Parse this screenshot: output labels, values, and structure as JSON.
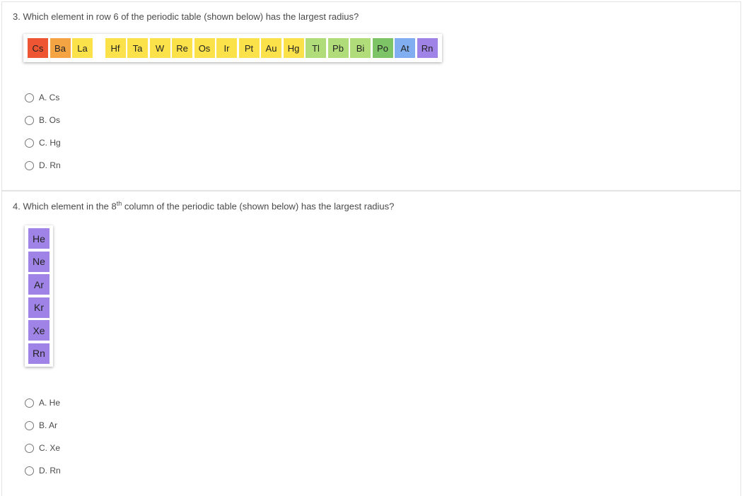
{
  "questions": [
    {
      "number": "3.",
      "text": "Which element in row 6 of the periodic table (shown below) has the largest radius?",
      "elements": [
        {
          "symbol": "Cs",
          "color": "#ee5533"
        },
        {
          "symbol": "Ba",
          "color": "#f5a444"
        },
        {
          "symbol": "La",
          "color": "#fce24a"
        },
        {
          "symbol": "Hf",
          "color": "#fce24a"
        },
        {
          "symbol": "Ta",
          "color": "#fce24a"
        },
        {
          "symbol": "W",
          "color": "#fce24a"
        },
        {
          "symbol": "Re",
          "color": "#fce24a"
        },
        {
          "symbol": "Os",
          "color": "#fce24a"
        },
        {
          "symbol": "Ir",
          "color": "#fce24a"
        },
        {
          "symbol": "Pt",
          "color": "#fce24a"
        },
        {
          "symbol": "Au",
          "color": "#fce24a"
        },
        {
          "symbol": "Hg",
          "color": "#fce24a"
        },
        {
          "symbol": "Tl",
          "color": "#b1dc7a"
        },
        {
          "symbol": "Pb",
          "color": "#b1dc7a"
        },
        {
          "symbol": "Bi",
          "color": "#b1dc7a"
        },
        {
          "symbol": "Po",
          "color": "#7cc466"
        },
        {
          "symbol": "At",
          "color": "#80aef0"
        },
        {
          "symbol": "Rn",
          "color": "#9f83e6"
        }
      ],
      "options": [
        "A. Cs",
        "B. Os",
        "C. Hg",
        "D. Rn"
      ]
    },
    {
      "number": "4.",
      "text_before": "Which element in the 8",
      "text_sup": "th",
      "text_after": " column of the periodic table (shown below) has the largest radius?",
      "elements": [
        {
          "symbol": "He",
          "color": "#9f83e6"
        },
        {
          "symbol": "Ne",
          "color": "#9f83e6"
        },
        {
          "symbol": "Ar",
          "color": "#9f83e6"
        },
        {
          "symbol": "Kr",
          "color": "#9f83e6"
        },
        {
          "symbol": "Xe",
          "color": "#9f83e6"
        },
        {
          "symbol": "Rn",
          "color": "#9f83e6"
        }
      ],
      "options": [
        "A. He",
        "B. Ar",
        "C. Xe",
        "D. Rn"
      ]
    }
  ]
}
